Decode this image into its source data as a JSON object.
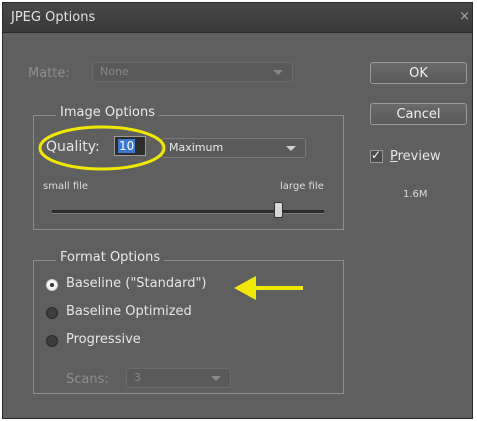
{
  "dialog": {
    "title": "JPEG Options",
    "close_glyph": "×"
  },
  "matte": {
    "label": "Matte:",
    "value": "None",
    "enabled": false
  },
  "image_options": {
    "legend": "Image Options",
    "quality_label": "Quality:",
    "quality_value": "10",
    "quality_preset": "Maximum",
    "slider_min_label": "small file",
    "slider_max_label": "large file",
    "slider_fraction": 0.83
  },
  "format_options": {
    "legend": "Format Options",
    "options": [
      {
        "label": "Baseline (\"Standard\")",
        "checked": true
      },
      {
        "label": "Baseline Optimized",
        "checked": false
      },
      {
        "label": "Progressive",
        "checked": false
      }
    ],
    "scans_label": "Scans:",
    "scans_value": "3",
    "scans_enabled": false
  },
  "buttons": {
    "ok": "OK",
    "cancel": "Cancel"
  },
  "preview": {
    "label": "Preview",
    "checked": true,
    "file_size": "1.6M"
  },
  "annotations": {
    "highlight_color": "#f0e800"
  },
  "colors": {
    "dialog_bg": "#5f5f5f",
    "title_bg": "#3f3f3f",
    "selection": "#3a78d4"
  },
  "icons": {
    "close": "close-icon",
    "dropdown": "chevron-down-icon",
    "check": "checkmark-icon",
    "annotation_arrow": "arrow-left-icon"
  }
}
